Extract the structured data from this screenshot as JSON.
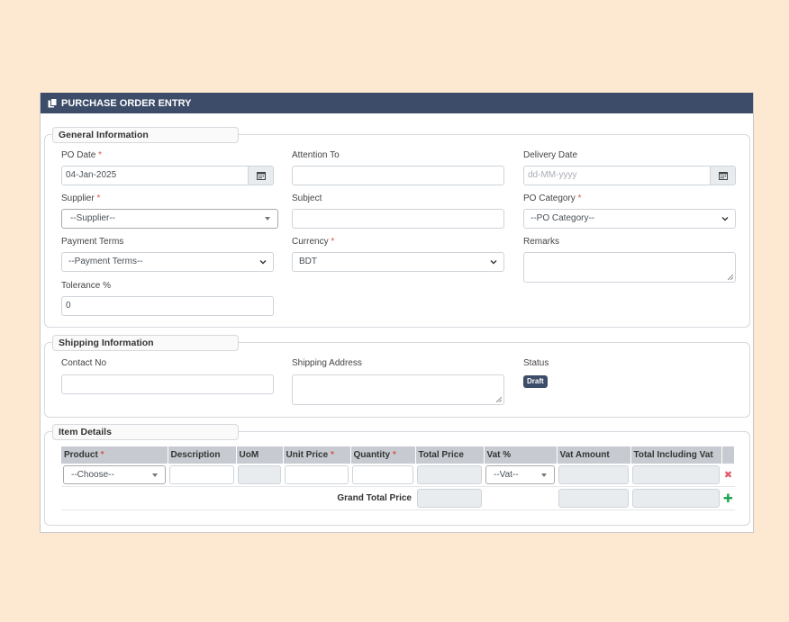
{
  "header": {
    "title": "PURCHASE ORDER ENTRY",
    "icon": "copy-document-icon"
  },
  "general": {
    "legend": "General Information",
    "po_date": {
      "label": "PO Date",
      "value": "04-Jan-2025"
    },
    "attention_to": {
      "label": "Attention To",
      "value": ""
    },
    "delivery_date": {
      "label": "Delivery Date",
      "placeholder": "dd-MM-yyyy"
    },
    "supplier": {
      "label": "Supplier",
      "value": "--Supplier--"
    },
    "subject": {
      "label": "Subject",
      "value": ""
    },
    "po_category": {
      "label": "PO Category",
      "value": "--PO Category--"
    },
    "payment_terms": {
      "label": "Payment Terms",
      "value": "--Payment Terms--"
    },
    "currency": {
      "label": "Currency",
      "value": "BDT"
    },
    "remarks": {
      "label": "Remarks",
      "value": ""
    },
    "tolerance": {
      "label": "Tolerance %",
      "value": "0"
    },
    "required_mark": "*"
  },
  "shipping": {
    "legend": "Shipping Information",
    "contact_no": {
      "label": "Contact No",
      "value": ""
    },
    "shipping_address": {
      "label": "Shipping Address",
      "value": ""
    },
    "status": {
      "label": "Status",
      "value": "Draft"
    }
  },
  "items": {
    "legend": "Item Details",
    "columns": [
      "Product",
      "Description",
      "UoM",
      "Unit Price",
      "Quantity",
      "Total Price",
      "Vat %",
      "Vat Amount",
      "Total Including Vat"
    ],
    "product_placeholder": "--Choose--",
    "vat_placeholder": "--Vat--",
    "grand_total_label": "Grand Total Price",
    "remove_icon": "✖",
    "add_icon": "✚"
  },
  "colors": {
    "header": "#3d4d69",
    "background": "#fde9d2",
    "required": "#d9534f"
  }
}
